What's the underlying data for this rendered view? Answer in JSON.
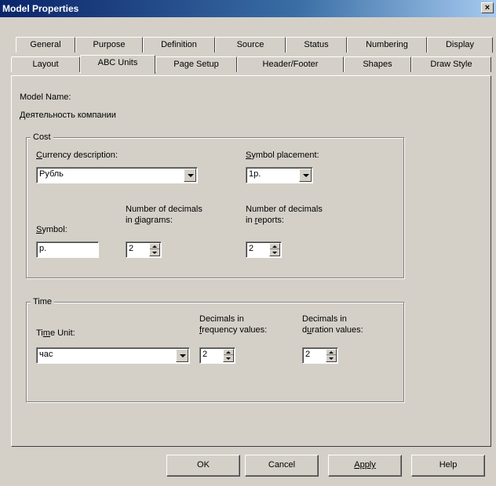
{
  "window": {
    "title": "Model Properties",
    "close_label": "×"
  },
  "tabs": {
    "row_top": [
      "General",
      "Purpose",
      "Definition",
      "Source",
      "Status",
      "Numbering",
      "Display"
    ],
    "row_bottom": [
      "Layout",
      "ABC Units",
      "Page Setup",
      "Header/Footer",
      "Shapes",
      "Draw Style"
    ],
    "active": "ABC Units"
  },
  "model": {
    "name_label": "Model Name:",
    "name_value": "Деятельность компании"
  },
  "cost": {
    "group_label": "Cost",
    "currency_label": "Currency description:",
    "currency_value": "Рубль",
    "placement_label": "Symbol placement:",
    "placement_value": "1р.",
    "symbol_label": "Symbol:",
    "symbol_value": "р.",
    "decimals_diagrams_label": [
      "Number of decimals",
      "in diagrams:"
    ],
    "decimals_diagrams_value": "2",
    "decimals_reports_label": [
      "Number of decimals",
      "in reports:"
    ],
    "decimals_reports_value": "2"
  },
  "time": {
    "group_label": "Time",
    "unit_label": "Time Unit:",
    "unit_value": "час",
    "freq_label": [
      "Decimals in",
      "frequency values:"
    ],
    "freq_value": "2",
    "dur_label": [
      "Decimals in",
      "duration values:"
    ],
    "dur_value": "2"
  },
  "buttons": {
    "ok": "OK",
    "cancel": "Cancel",
    "apply": "Apply",
    "help": "Help"
  }
}
